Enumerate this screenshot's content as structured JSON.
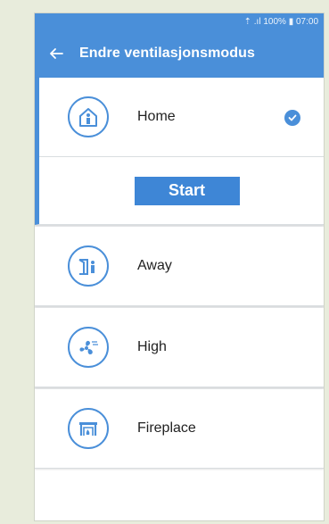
{
  "status_bar": {
    "text": "⇡ .ıl 100% ▮ 07:00"
  },
  "app_bar": {
    "title": "Endre ventilasjonsmodus",
    "back_icon": "arrow-left-icon"
  },
  "modes": [
    {
      "id": "home",
      "label": "Home",
      "icon": "home-icon",
      "selected": true
    },
    {
      "id": "away",
      "label": "Away",
      "icon": "away-icon",
      "selected": false
    },
    {
      "id": "high",
      "label": "High",
      "icon": "fan-icon",
      "selected": false
    },
    {
      "id": "fireplace",
      "label": "Fireplace",
      "icon": "fireplace-icon",
      "selected": false
    }
  ],
  "start_button": {
    "label": "Start"
  },
  "colors": {
    "accent": "#4a8fd9",
    "button": "#3e86d6",
    "background": "#e8ecdc"
  }
}
